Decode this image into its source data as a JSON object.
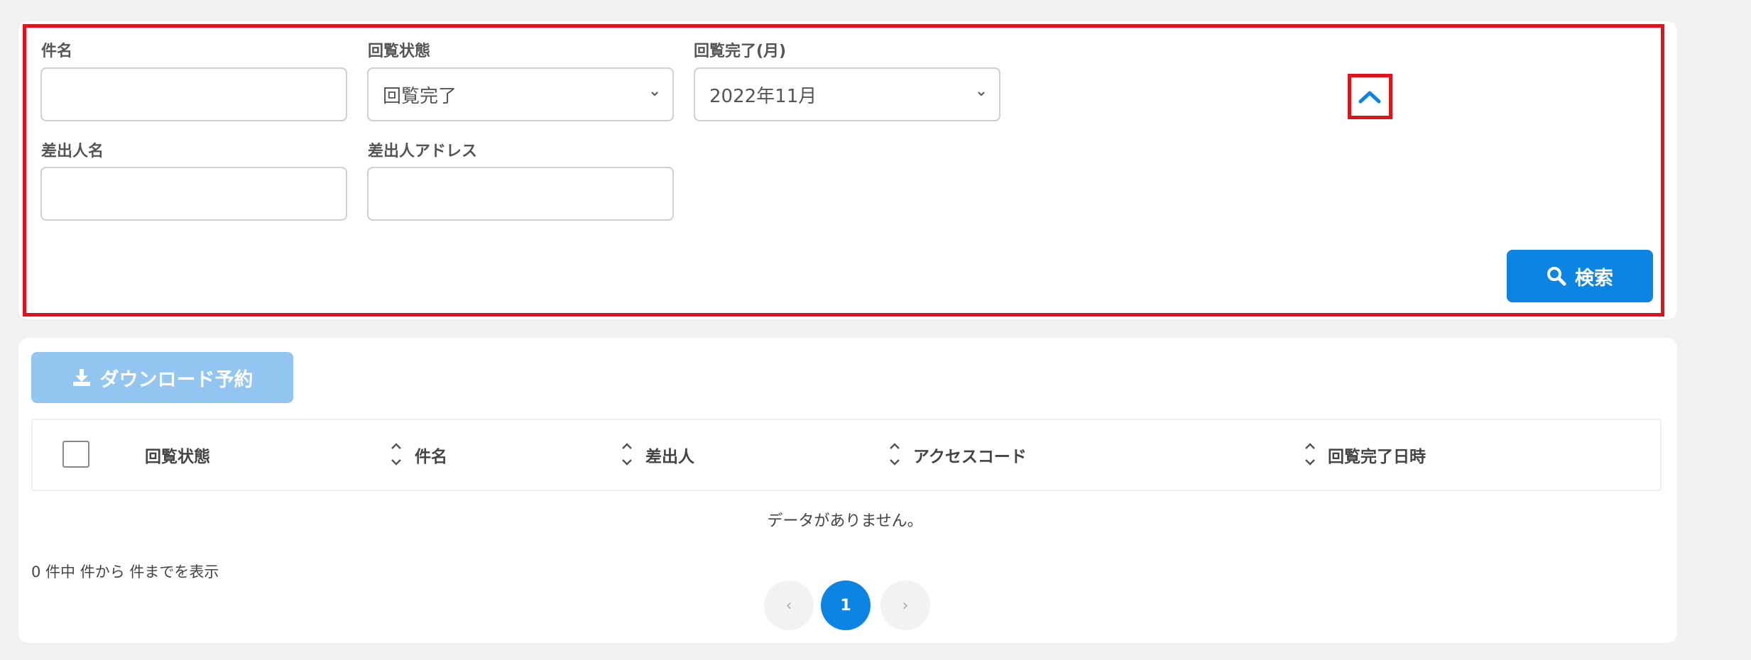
{
  "search_form": {
    "subject_label": "件名",
    "subject_value": "",
    "circulation_status_label": "回覧状態",
    "circulation_status_value": "回覧完了",
    "completion_month_label": "回覧完了(月)",
    "completion_month_value": "2022年11月",
    "sender_name_label": "差出人名",
    "sender_name_value": "",
    "sender_address_label": "差出人アドレス",
    "sender_address_value": "",
    "collapse_icon": "chevron-up-icon",
    "search_button_label": "検索",
    "search_icon": "search-icon"
  },
  "results": {
    "download_button_label": "ダウンロード予約",
    "download_icon": "download-icon",
    "columns": [
      "回覧状態",
      "件名",
      "差出人",
      "アクセスコード",
      "回覧完了日時"
    ],
    "empty_message": "データがありません。",
    "count_text": "0 件中 件から 件までを表示"
  },
  "pagination": {
    "prev": "‹",
    "current": "1",
    "next": "›"
  },
  "colors": {
    "accent": "#0c84e4",
    "accent_disabled": "#92c6f1",
    "highlight": "#e3121a"
  }
}
